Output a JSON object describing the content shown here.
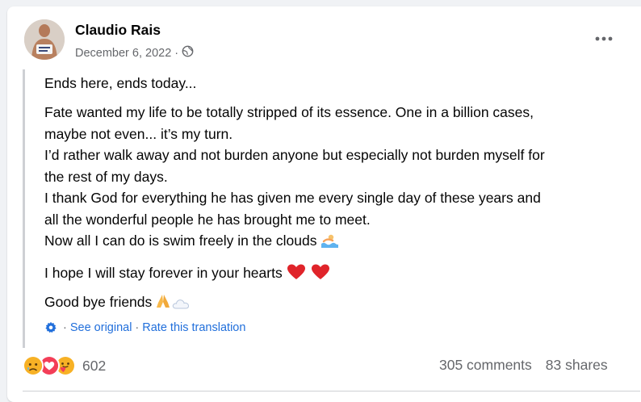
{
  "post": {
    "author": "Claudio Rais",
    "date": "December 6, 2022",
    "dot": "·",
    "paragraphs": [
      "Ends here, ends today...",
      [
        "Fate wanted my life to be totally stripped of its essence. One in a billion cases,",
        "maybe not even... it’s my turn.",
        "I’d rather walk away and not burden anyone but especially not burden myself for",
        "the rest of my days.",
        "I thank God for everything he has given me every single day of these years and",
        "all the wonderful people he has brought me to meet.",
        "Now all I can do is swim freely in the clouds"
      ],
      "I hope I will stay forever in your hearts",
      "Good bye friends"
    ],
    "translation": {
      "see_original": "See original",
      "separator": "·",
      "rate": "Rate this translation"
    },
    "reactions": {
      "count": "602",
      "types": [
        "sad-reaction-icon",
        "love-reaction-icon",
        "care-reaction-icon"
      ]
    },
    "comments": "305 comments",
    "shares": "83 shares"
  },
  "colors": {
    "link": "#216fdb",
    "secondary_text": "#65676b",
    "love": "#f33e58",
    "reaction_yellow": "#f7b125"
  }
}
